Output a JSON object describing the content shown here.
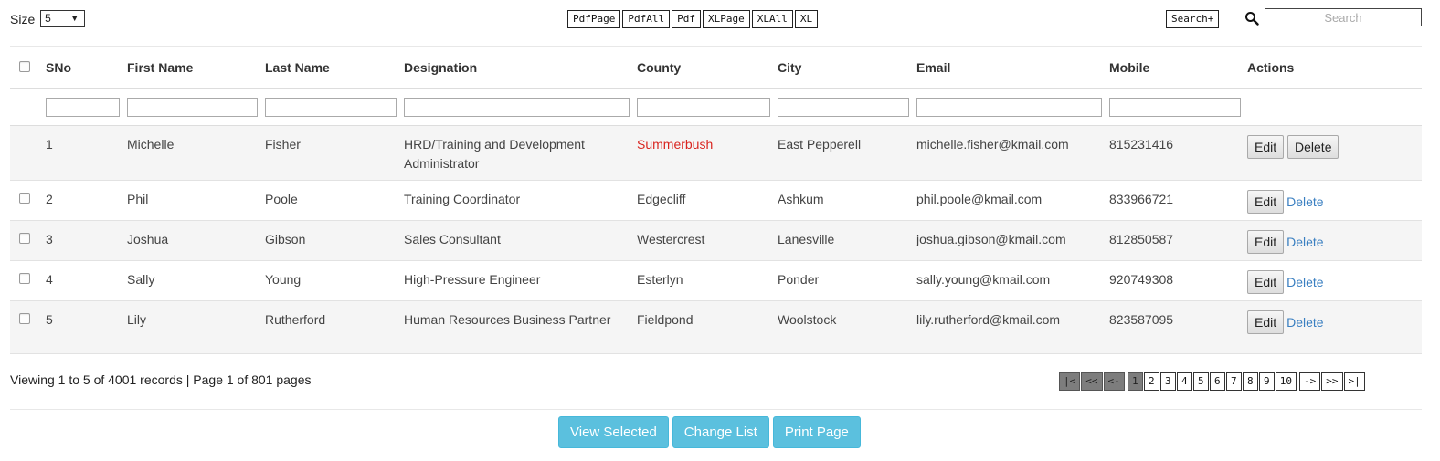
{
  "toolbar": {
    "size_label": "Size",
    "size_value": "5",
    "export_buttons": [
      "PdfPage",
      "PdfAll",
      "Pdf",
      "XLPage",
      "XLAll",
      "XL"
    ],
    "search_plus_label": "Search+",
    "search_placeholder": "Search",
    "search_value": ""
  },
  "table": {
    "columns": [
      "SNo",
      "First Name",
      "Last Name",
      "Designation",
      "County",
      "City",
      "Email",
      "Mobile",
      "Actions"
    ],
    "rows": [
      {
        "sno": "1",
        "first": "Michelle",
        "last": "Fisher",
        "designation": "HRD/Training and Development Administrator",
        "county": "Summerbush",
        "city": "East Pepperell",
        "email": "michelle.fisher@kmail.com",
        "mobile": "815231416",
        "edit": "Edit",
        "delete": "Delete"
      },
      {
        "sno": "2",
        "first": "Phil",
        "last": "Poole",
        "designation": "Training Coordinator",
        "county": "Edgecliff",
        "city": "Ashkum",
        "email": "phil.poole@kmail.com",
        "mobile": "833966721",
        "edit": "Edit",
        "delete": "Delete"
      },
      {
        "sno": "3",
        "first": "Joshua",
        "last": "Gibson",
        "designation": "Sales Consultant",
        "county": "Westercrest",
        "city": "Lanesville",
        "email": "joshua.gibson@kmail.com",
        "mobile": "812850587",
        "edit": "Edit",
        "delete": "Delete"
      },
      {
        "sno": "4",
        "first": "Sally",
        "last": "Young",
        "designation": "High-Pressure Engineer",
        "county": "Esterlyn",
        "city": "Ponder",
        "email": "sally.young@kmail.com",
        "mobile": "920749308",
        "edit": "Edit",
        "delete": "Delete"
      },
      {
        "sno": "5",
        "first": "Lily",
        "last": "Rutherford",
        "designation": "Human Resources Business Partner",
        "county": "Fieldpond",
        "city": "Woolstock",
        "email": "lily.rutherford@kmail.com",
        "mobile": "823587095",
        "edit": "Edit",
        "delete": "Delete"
      }
    ]
  },
  "footer": {
    "viewing_text": "Viewing 1 to 5 of 4001 records | Page 1 of 801 pages",
    "pager": {
      "first": "|<",
      "prev_block": "<<",
      "prev": "<-",
      "pages": [
        "1",
        "2",
        "3",
        "4",
        "5",
        "6",
        "7",
        "8",
        "9",
        "10"
      ],
      "current_page": "1",
      "next": "->",
      "next_block": ">>",
      "last": ">|"
    },
    "buttons": [
      "View Selected",
      "Change List",
      "Print Page"
    ]
  },
  "colors": {
    "accent_blue": "#5bc0de",
    "link_blue": "#3a7fc1",
    "highlight_red": "#d9241f",
    "row_stripe": "#f5f5f5"
  }
}
